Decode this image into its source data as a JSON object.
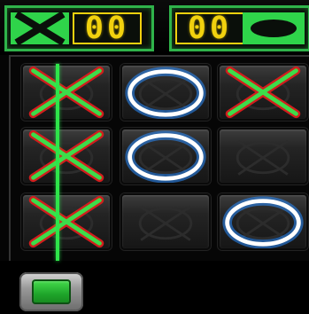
{
  "score": {
    "player_x": {
      "mark_icon": "x-mark-icon",
      "value": "00"
    },
    "player_o": {
      "mark_icon": "o-mark-icon",
      "value": "00"
    }
  },
  "board": {
    "cells": [
      [
        "X",
        "O",
        "X"
      ],
      [
        "X",
        "O",
        ""
      ],
      [
        "X",
        "",
        "O"
      ]
    ],
    "winning_line": {
      "type": "column",
      "index": 0,
      "color": "#2ee54a"
    }
  },
  "colors": {
    "x_stroke": "#3ddc4a",
    "x_outline": "#d21d1d",
    "o_stroke": "#ffffff",
    "o_glow": "#2a8cff",
    "score_digit": "#f1d10e",
    "panel_border": "#2fb34a"
  },
  "menu_button": {
    "icon": "green-square-button-icon"
  }
}
